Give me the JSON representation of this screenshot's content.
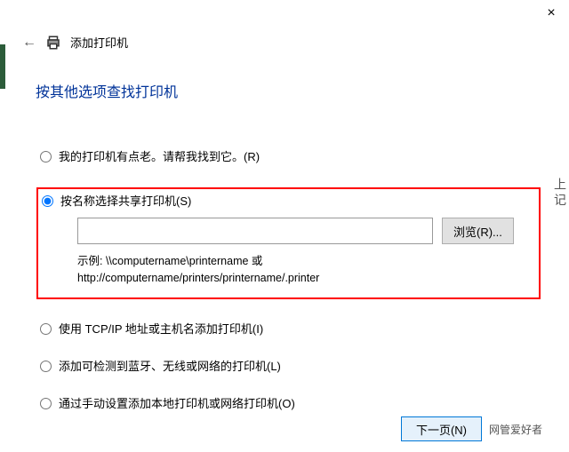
{
  "window": {
    "close": "×"
  },
  "header": {
    "title": "添加打印机"
  },
  "heading": "按其他选项查找打印机",
  "options": {
    "opt1": "我的打印机有点老。请帮我找到它。(R)",
    "opt2": "按名称选择共享打印机(S)",
    "opt3": "使用 TCP/IP 地址或主机名添加打印机(I)",
    "opt4": "添加可检测到蓝牙、无线或网络的打印机(L)",
    "opt5": "通过手动设置添加本地打印机或网络打印机(O)"
  },
  "input": {
    "path_value": "",
    "browse": "浏览(R)..."
  },
  "example": {
    "line1": "示例: \\\\computername\\printername 或",
    "line2": "http://computername/printers/printername/.printer"
  },
  "footer": {
    "next": "下一页(N)",
    "watermark": "网管爱好者"
  },
  "side": "上 记"
}
